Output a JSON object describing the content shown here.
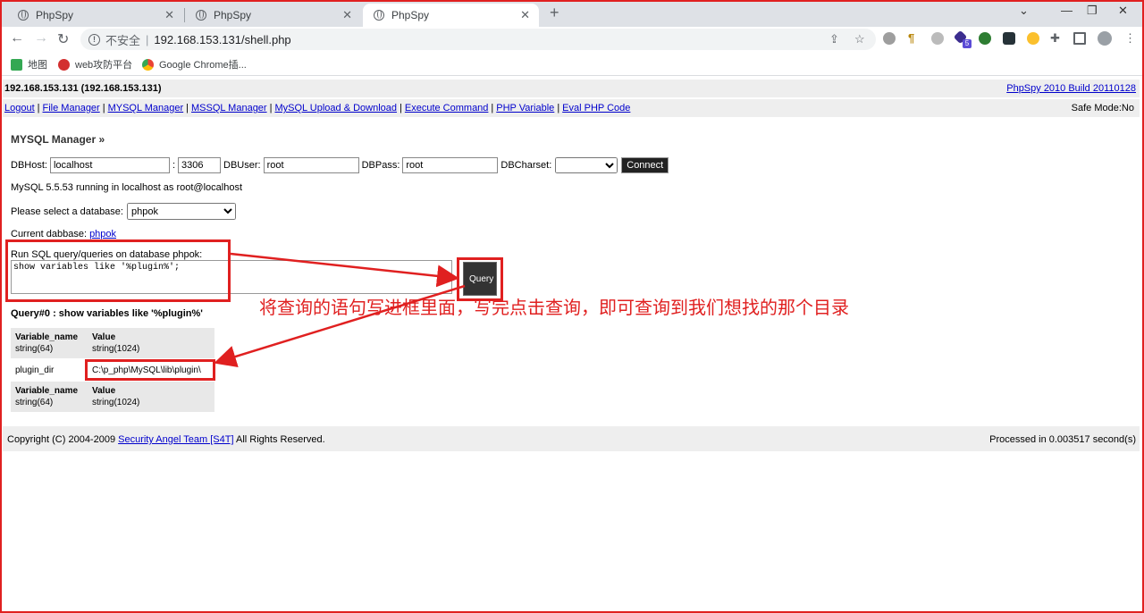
{
  "browser": {
    "tabs": [
      {
        "title": "PhpSpy",
        "active": false
      },
      {
        "title": "PhpSpy",
        "active": false
      },
      {
        "title": "PhpSpy",
        "active": true
      }
    ],
    "insecure_label": "不安全",
    "url": "192.168.153.131/shell.php",
    "bookmarks": [
      "地图",
      "web攻防平台",
      "Google Chrome插..."
    ],
    "extension_badge": "5"
  },
  "page": {
    "host_info": "192.168.153.131 (192.168.153.131)",
    "build_link": "PhpSpy 2010 Build 20110128",
    "menu": [
      "Logout",
      "File Manager",
      "MYSQL Manager",
      "MSSQL Manager",
      "MySQL Upload & Download",
      "Execute Command",
      "PHP Variable",
      "Eval PHP Code"
    ],
    "safe_mode": "Safe Mode:No",
    "section_title": "MYSQL Manager »",
    "conn": {
      "dbhost_label": "DBHost:",
      "dbhost": "localhost",
      "colon": ":",
      "port": "3306",
      "dbuser_label": "DBUser:",
      "dbuser": "root",
      "dbpass_label": "DBPass:",
      "dbpass": "root",
      "dbcharset_label": "DBCharset:",
      "connect_label": "Connect"
    },
    "status": "MySQL 5.5.53 running in localhost as root@localhost",
    "select_db_label": "Please select a database:",
    "selected_db": "phpok",
    "current_db_label": "Current dabbase:",
    "current_db": "phpok",
    "run_label": "Run SQL query/queries on database phpok:",
    "sql": "show variables like '%plugin%';",
    "query_label": "Query",
    "query_title": "Query#0 : show variables like '%plugin%'",
    "result": {
      "header": [
        {
          "name": "Variable_name",
          "type": "string(64)"
        },
        {
          "name": "Value",
          "type": "string(1024)"
        }
      ],
      "rows": [
        [
          "plugin_dir",
          "C:\\p_php\\MySQL\\lib\\plugin\\"
        ]
      ]
    },
    "footer": {
      "copyright_pre": "Copyright (C) 2004-2009 ",
      "copyright_link": "Security Angel Team [S4T]",
      "copyright_post": " All Rights Reserved.",
      "processed": "Processed in 0.003517 second(s)"
    }
  },
  "annotation": "将查询的语句写进框里面，写完点击查询，即可查询到我们想找的那个目录",
  "colors": {
    "annotation_red": "#e02020",
    "link_blue": "#0000cc",
    "bar_gray": "#eeeeee"
  }
}
